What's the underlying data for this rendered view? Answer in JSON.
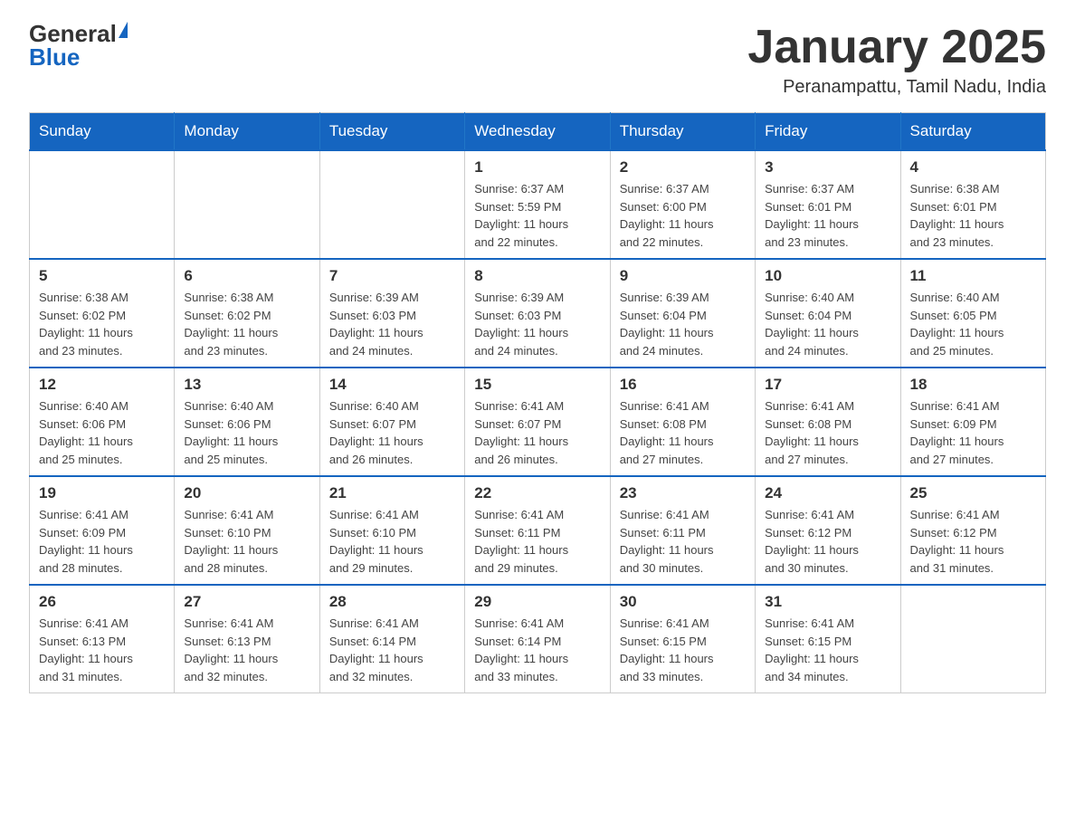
{
  "logo": {
    "general": "General",
    "blue": "Blue"
  },
  "title": "January 2025",
  "subtitle": "Peranampattu, Tamil Nadu, India",
  "days_of_week": [
    "Sunday",
    "Monday",
    "Tuesday",
    "Wednesday",
    "Thursday",
    "Friday",
    "Saturday"
  ],
  "weeks": [
    [
      {
        "day": "",
        "info": ""
      },
      {
        "day": "",
        "info": ""
      },
      {
        "day": "",
        "info": ""
      },
      {
        "day": "1",
        "info": "Sunrise: 6:37 AM\nSunset: 5:59 PM\nDaylight: 11 hours\nand 22 minutes."
      },
      {
        "day": "2",
        "info": "Sunrise: 6:37 AM\nSunset: 6:00 PM\nDaylight: 11 hours\nand 22 minutes."
      },
      {
        "day": "3",
        "info": "Sunrise: 6:37 AM\nSunset: 6:01 PM\nDaylight: 11 hours\nand 23 minutes."
      },
      {
        "day": "4",
        "info": "Sunrise: 6:38 AM\nSunset: 6:01 PM\nDaylight: 11 hours\nand 23 minutes."
      }
    ],
    [
      {
        "day": "5",
        "info": "Sunrise: 6:38 AM\nSunset: 6:02 PM\nDaylight: 11 hours\nand 23 minutes."
      },
      {
        "day": "6",
        "info": "Sunrise: 6:38 AM\nSunset: 6:02 PM\nDaylight: 11 hours\nand 23 minutes."
      },
      {
        "day": "7",
        "info": "Sunrise: 6:39 AM\nSunset: 6:03 PM\nDaylight: 11 hours\nand 24 minutes."
      },
      {
        "day": "8",
        "info": "Sunrise: 6:39 AM\nSunset: 6:03 PM\nDaylight: 11 hours\nand 24 minutes."
      },
      {
        "day": "9",
        "info": "Sunrise: 6:39 AM\nSunset: 6:04 PM\nDaylight: 11 hours\nand 24 minutes."
      },
      {
        "day": "10",
        "info": "Sunrise: 6:40 AM\nSunset: 6:04 PM\nDaylight: 11 hours\nand 24 minutes."
      },
      {
        "day": "11",
        "info": "Sunrise: 6:40 AM\nSunset: 6:05 PM\nDaylight: 11 hours\nand 25 minutes."
      }
    ],
    [
      {
        "day": "12",
        "info": "Sunrise: 6:40 AM\nSunset: 6:06 PM\nDaylight: 11 hours\nand 25 minutes."
      },
      {
        "day": "13",
        "info": "Sunrise: 6:40 AM\nSunset: 6:06 PM\nDaylight: 11 hours\nand 25 minutes."
      },
      {
        "day": "14",
        "info": "Sunrise: 6:40 AM\nSunset: 6:07 PM\nDaylight: 11 hours\nand 26 minutes."
      },
      {
        "day": "15",
        "info": "Sunrise: 6:41 AM\nSunset: 6:07 PM\nDaylight: 11 hours\nand 26 minutes."
      },
      {
        "day": "16",
        "info": "Sunrise: 6:41 AM\nSunset: 6:08 PM\nDaylight: 11 hours\nand 27 minutes."
      },
      {
        "day": "17",
        "info": "Sunrise: 6:41 AM\nSunset: 6:08 PM\nDaylight: 11 hours\nand 27 minutes."
      },
      {
        "day": "18",
        "info": "Sunrise: 6:41 AM\nSunset: 6:09 PM\nDaylight: 11 hours\nand 27 minutes."
      }
    ],
    [
      {
        "day": "19",
        "info": "Sunrise: 6:41 AM\nSunset: 6:09 PM\nDaylight: 11 hours\nand 28 minutes."
      },
      {
        "day": "20",
        "info": "Sunrise: 6:41 AM\nSunset: 6:10 PM\nDaylight: 11 hours\nand 28 minutes."
      },
      {
        "day": "21",
        "info": "Sunrise: 6:41 AM\nSunset: 6:10 PM\nDaylight: 11 hours\nand 29 minutes."
      },
      {
        "day": "22",
        "info": "Sunrise: 6:41 AM\nSunset: 6:11 PM\nDaylight: 11 hours\nand 29 minutes."
      },
      {
        "day": "23",
        "info": "Sunrise: 6:41 AM\nSunset: 6:11 PM\nDaylight: 11 hours\nand 30 minutes."
      },
      {
        "day": "24",
        "info": "Sunrise: 6:41 AM\nSunset: 6:12 PM\nDaylight: 11 hours\nand 30 minutes."
      },
      {
        "day": "25",
        "info": "Sunrise: 6:41 AM\nSunset: 6:12 PM\nDaylight: 11 hours\nand 31 minutes."
      }
    ],
    [
      {
        "day": "26",
        "info": "Sunrise: 6:41 AM\nSunset: 6:13 PM\nDaylight: 11 hours\nand 31 minutes."
      },
      {
        "day": "27",
        "info": "Sunrise: 6:41 AM\nSunset: 6:13 PM\nDaylight: 11 hours\nand 32 minutes."
      },
      {
        "day": "28",
        "info": "Sunrise: 6:41 AM\nSunset: 6:14 PM\nDaylight: 11 hours\nand 32 minutes."
      },
      {
        "day": "29",
        "info": "Sunrise: 6:41 AM\nSunset: 6:14 PM\nDaylight: 11 hours\nand 33 minutes."
      },
      {
        "day": "30",
        "info": "Sunrise: 6:41 AM\nSunset: 6:15 PM\nDaylight: 11 hours\nand 33 minutes."
      },
      {
        "day": "31",
        "info": "Sunrise: 6:41 AM\nSunset: 6:15 PM\nDaylight: 11 hours\nand 34 minutes."
      },
      {
        "day": "",
        "info": ""
      }
    ]
  ]
}
